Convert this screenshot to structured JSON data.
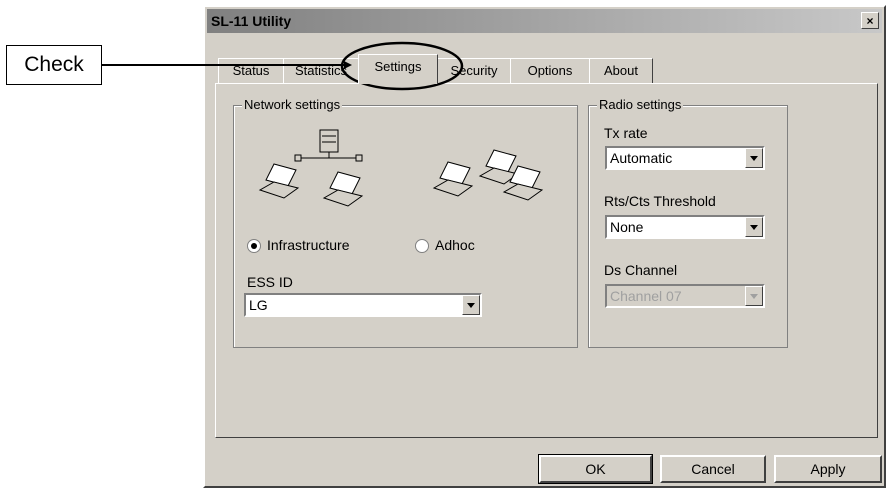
{
  "annotation": {
    "callout_label": "Check"
  },
  "window": {
    "title": "SL-11 Utility",
    "close_label": "×"
  },
  "tabs": [
    {
      "label": "Status"
    },
    {
      "label": "Statistics"
    },
    {
      "label": "Settings",
      "active": true
    },
    {
      "label": "Security"
    },
    {
      "label": "Options"
    },
    {
      "label": "About"
    }
  ],
  "network_settings": {
    "title": "Network settings",
    "modes": [
      {
        "label": "Infrastructure",
        "selected": true
      },
      {
        "label": "Adhoc",
        "selected": false
      }
    ],
    "ess_id_label": "ESS ID",
    "ess_id_value": "LG"
  },
  "radio_settings": {
    "title": "Radio settings",
    "tx_rate_label": "Tx rate",
    "tx_rate_value": "Automatic",
    "rts_label": "Rts/Cts Threshold",
    "rts_value": "None",
    "ds_channel_label": "Ds Channel",
    "ds_channel_value": "Channel 07"
  },
  "buttons": {
    "ok": "OK",
    "cancel": "Cancel",
    "apply": "Apply"
  }
}
